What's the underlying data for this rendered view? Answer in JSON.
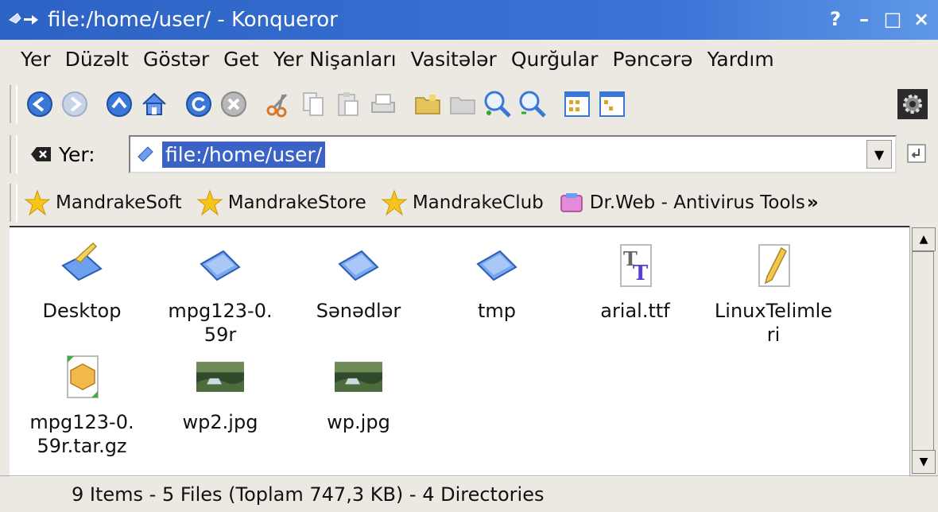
{
  "window": {
    "title": "file:/home/user/ - Konqueror",
    "controls": [
      "?",
      "–",
      "□",
      "×"
    ]
  },
  "menu": [
    "Yer",
    "Düzəlt",
    "Göstər",
    "Get",
    "Yer Nişanları",
    "Vasitələr",
    "Qurğular",
    "Pəncərə",
    "Yardım"
  ],
  "toolbar": {
    "icons": [
      "back-icon",
      "forward-icon",
      "up-icon",
      "home-icon",
      "reload-icon",
      "stop-icon",
      "cut-icon",
      "copy-icon",
      "paste-icon",
      "print-icon",
      "folder-icon",
      "folder-icon",
      "zoom-in-icon",
      "zoom-out-icon",
      "icon-view-icon",
      "tree-view-icon",
      "gear-icon"
    ]
  },
  "location": {
    "label": "Yer:",
    "value": "file:/home/user/"
  },
  "bookmarks": [
    "MandrakeSoft",
    "MandrakeStore",
    "MandrakeClub",
    "Dr.Web - Antivirus Tools",
    "»"
  ],
  "files": [
    {
      "name_line1": "Desktop",
      "name_line2": "",
      "icon": "desktop-icon"
    },
    {
      "name_line1": "mpg123-0.",
      "name_line2": "59r",
      "icon": "folder-icon"
    },
    {
      "name_line1": "Sənədlər",
      "name_line2": "",
      "icon": "folder-icon"
    },
    {
      "name_line1": "tmp",
      "name_line2": "",
      "icon": "folder-icon"
    },
    {
      "name_line1": "arial.ttf",
      "name_line2": "",
      "icon": "font-icon"
    },
    {
      "name_line1": "LinuxTelimle",
      "name_line2": "ri",
      "icon": "text-file-icon"
    },
    {
      "name_line1": "mpg123-0.",
      "name_line2": "59r.tar.gz",
      "icon": "archive-icon"
    },
    {
      "name_line1": "wp2.jpg",
      "name_line2": "",
      "icon": "image-thumbnail-icon"
    },
    {
      "name_line1": "wp.jpg",
      "name_line2": "",
      "icon": "image-thumbnail-icon"
    }
  ],
  "status": "9 Items - 5 Files (Toplam 747,3 KB) - 4 Directories"
}
